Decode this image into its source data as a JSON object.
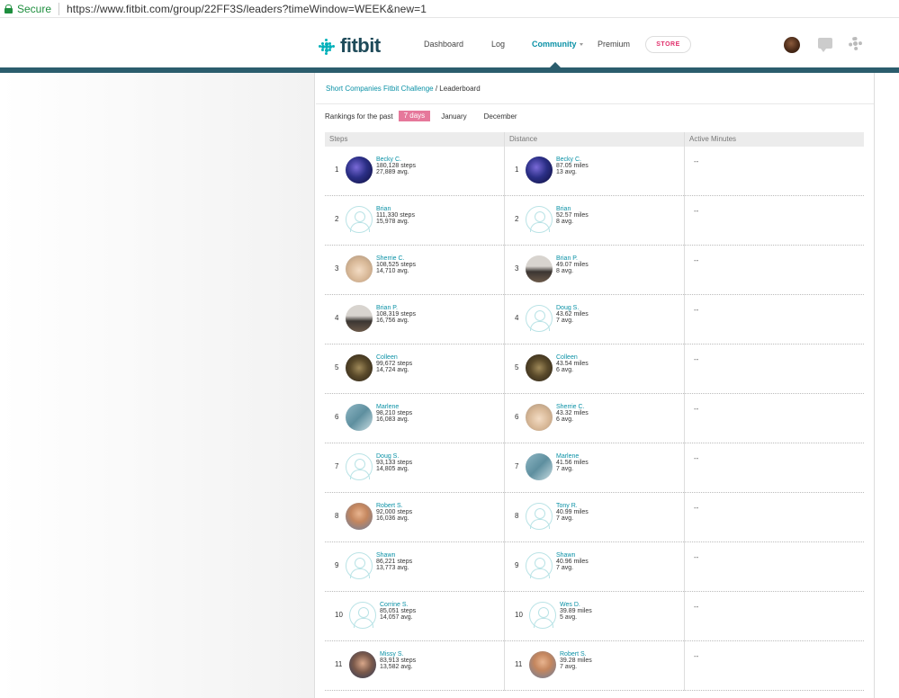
{
  "browser": {
    "secure_label": "Secure",
    "url": "https://www.fitbit.com/group/22FF3S/leaders?timeWindow=WEEK&new=1"
  },
  "nav": {
    "logo": "fitbit",
    "links": [
      "Dashboard",
      "Log",
      "Community",
      "Premium"
    ],
    "active": "Community",
    "store": "STORE"
  },
  "breadcrumb": {
    "group": "Short Companies Fitbit Challenge",
    "sep": " / ",
    "current": "Leaderboard"
  },
  "rankings": {
    "label": "Rankings for the past",
    "options": [
      "7 days",
      "January",
      "December"
    ],
    "selected": "7 days"
  },
  "table": {
    "headers": [
      "Steps",
      "Distance",
      "Active Minutes"
    ],
    "rows": [
      {
        "rank": "1",
        "steps": {
          "name": "Becky C.",
          "value": "180,128 steps",
          "avg": "27,889 avg.",
          "avatar": "becky"
        },
        "distance": {
          "name": "Becky C.",
          "value": "87.05 miles",
          "avg": "13 avg.",
          "avatar": "becky"
        },
        "active": "--"
      },
      {
        "rank": "2",
        "steps": {
          "name": "Brian",
          "value": "111,330 steps",
          "avg": "15,978 avg.",
          "avatar": "default"
        },
        "distance": {
          "name": "Brian",
          "value": "52.57 miles",
          "avg": "8 avg.",
          "avatar": "default"
        },
        "active": "--"
      },
      {
        "rank": "3",
        "steps": {
          "name": "Sherrie C.",
          "value": "108,525 steps",
          "avg": "14,710 avg.",
          "avatar": "sherrie"
        },
        "distance": {
          "name": "Brian P.",
          "value": "49.07 miles",
          "avg": "8 avg.",
          "avatar": "brianp"
        },
        "active": "--"
      },
      {
        "rank": "4",
        "steps": {
          "name": "Brian P.",
          "value": "108,319 steps",
          "avg": "16,756 avg.",
          "avatar": "brianp"
        },
        "distance": {
          "name": "Doug S.",
          "value": "43.62 miles",
          "avg": "7 avg.",
          "avatar": "default"
        },
        "active": "--"
      },
      {
        "rank": "5",
        "steps": {
          "name": "Colleen",
          "value": "99,672 steps",
          "avg": "14,724 avg.",
          "avatar": "colleen"
        },
        "distance": {
          "name": "Colleen",
          "value": "43.54 miles",
          "avg": "6 avg.",
          "avatar": "colleen"
        },
        "active": "--"
      },
      {
        "rank": "6",
        "steps": {
          "name": "Marlene",
          "value": "98,210 steps",
          "avg": "16,083 avg.",
          "avatar": "marlene"
        },
        "distance": {
          "name": "Sherrie C.",
          "value": "43.32 miles",
          "avg": "6 avg.",
          "avatar": "sherrie"
        },
        "active": "--"
      },
      {
        "rank": "7",
        "steps": {
          "name": "Doug S.",
          "value": "93,133 steps",
          "avg": "14,805 avg.",
          "avatar": "default"
        },
        "distance": {
          "name": "Marlene",
          "value": "41.56 miles",
          "avg": "7 avg.",
          "avatar": "marlene"
        },
        "active": "--"
      },
      {
        "rank": "8",
        "steps": {
          "name": "Robert S.",
          "value": "92,000 steps",
          "avg": "16,036 avg.",
          "avatar": "robert"
        },
        "distance": {
          "name": "Tony R.",
          "value": "40.99 miles",
          "avg": "7 avg.",
          "avatar": "default"
        },
        "active": "--"
      },
      {
        "rank": "9",
        "steps": {
          "name": "Shawn",
          "value": "86,221 steps",
          "avg": "13,773 avg.",
          "avatar": "default"
        },
        "distance": {
          "name": "Shawn",
          "value": "40.96 miles",
          "avg": "7 avg.",
          "avatar": "default"
        },
        "active": "--"
      },
      {
        "rank": "10",
        "steps": {
          "name": "Corrine S.",
          "value": "85,051 steps",
          "avg": "14,057 avg.",
          "avatar": "default"
        },
        "distance": {
          "name": "Wes D.",
          "value": "39.89 miles",
          "avg": "5 avg.",
          "avatar": "default"
        },
        "active": "--"
      },
      {
        "rank": "11",
        "steps": {
          "name": "Missy S.",
          "value": "83,913 steps",
          "avg": "13,582 avg.",
          "avatar": "missy"
        },
        "distance": {
          "name": "Robert S.",
          "value": "39.28 miles",
          "avg": "7 avg.",
          "avatar": "robert"
        },
        "active": "--"
      }
    ]
  }
}
